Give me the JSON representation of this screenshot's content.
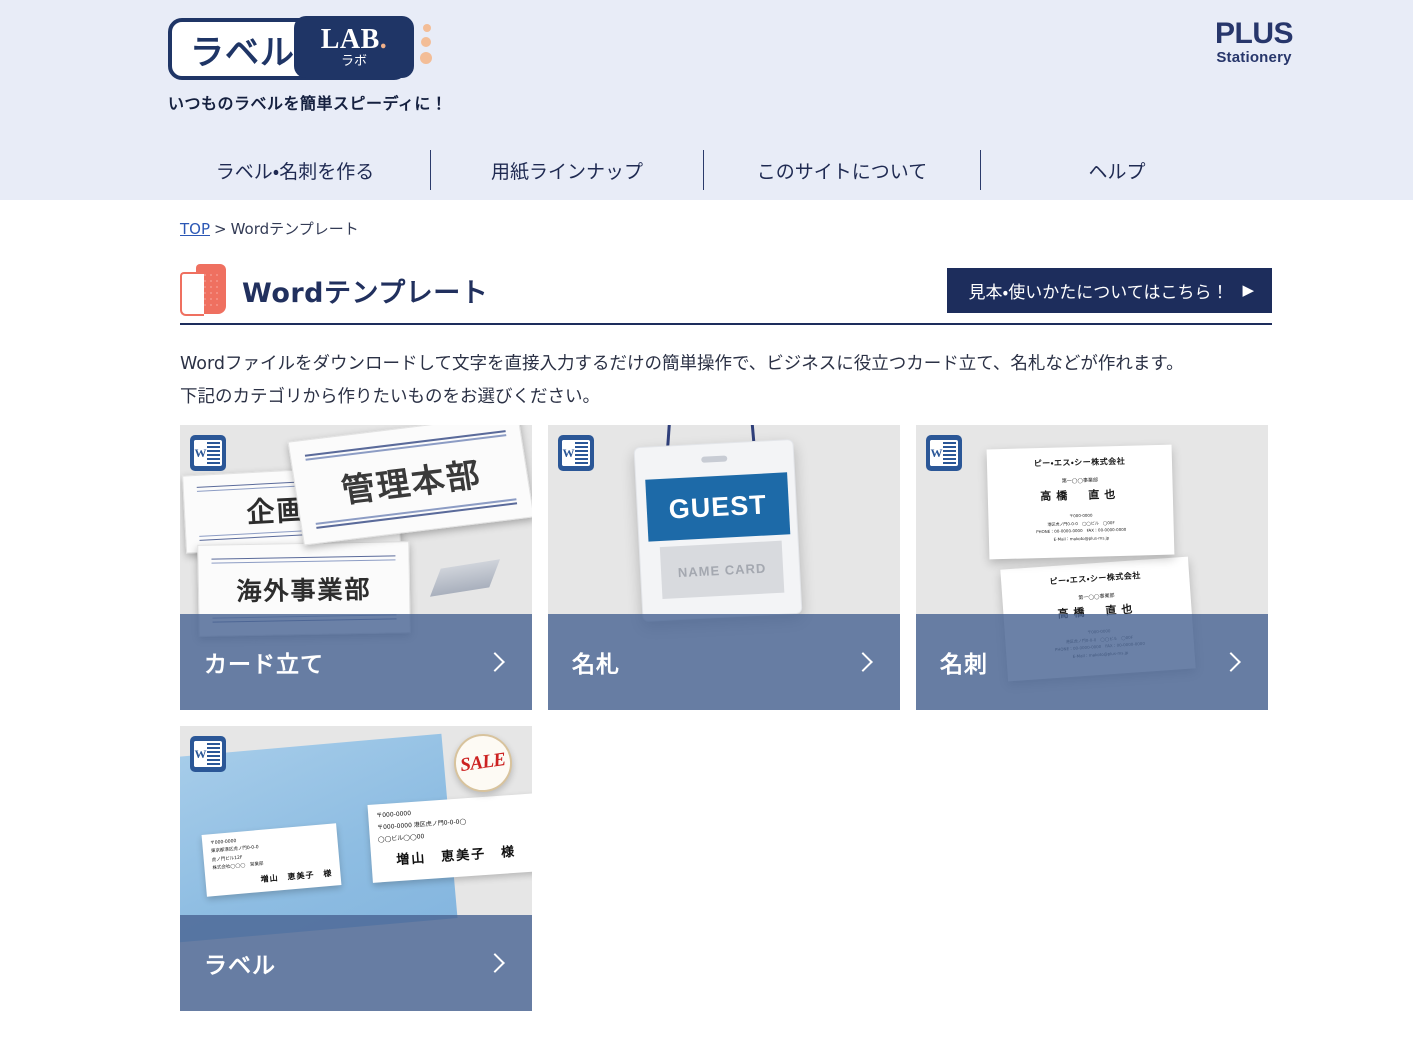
{
  "header": {
    "logo": {
      "jp_text": "ラベル",
      "lab_text": "LAB",
      "lab_dot": ".",
      "lab_sub": "ラボ",
      "tagline": "いつものラベルを簡単スピーディに！"
    },
    "brand": {
      "main": "PLUS",
      "sub": "Stationery"
    },
    "nav": [
      {
        "label": "ラベル・名刺を作る"
      },
      {
        "label": "用紙ラインナップ"
      },
      {
        "label": "このサイトについて"
      },
      {
        "label": "ヘルプ"
      }
    ]
  },
  "breadcrumb": {
    "home": "TOP",
    "separator": ">",
    "current": "Wordテンプレート"
  },
  "page": {
    "title": "Wordテンプレート",
    "guide_button": "見本・使いかたについてはこちら！",
    "guide_arrow": "▶",
    "lead_line1": "Wordファイルをダウンロードして文字を直接入力するだけの簡単操作で、ビジネスに役立つカード立て、名札などが作れます。",
    "lead_line2": "下記のカテゴリから作りたいものをお選びください。"
  },
  "cards": [
    {
      "label": "カード立て",
      "icon": "word-icon",
      "art": {
        "plate_a": "企画部",
        "plate_b": "管理本部",
        "plate_c": "海外事業部"
      }
    },
    {
      "label": "名札",
      "icon": "word-icon",
      "art": {
        "guest": "GUEST",
        "namecard": "NAME CARD"
      }
    },
    {
      "label": "名刺",
      "icon": "word-icon",
      "art": {
        "company": "ピー・エス・シー株式会社",
        "department": "第一◯◯事業部",
        "name": "高橋　直也",
        "info_line1": "〒000-0000",
        "info_line2": "港区虎ノ門0-0-0　◯◯ビル　◯00F",
        "info_line3": "PHONE：00-0000-0000　FAX：00-0000-0000",
        "info_line4": "E-Mail：makoto@plus-ms.jp"
      }
    },
    {
      "label": "ラベル",
      "icon": "word-icon",
      "art": {
        "label1_line1": "〒000-0000",
        "label1_line2": "東京都港区虎ノ門0-0-0",
        "label1_line3": "虎ノ門ビル12F",
        "label1_line4": "株式会社◯◯◯　営業部",
        "label1_name": "増山　恵美子　様",
        "label2_line1": "〒000-0000",
        "label2_line2": "〒000-0000 港区虎ノ門0-0-0◯",
        "label2_line3": "◯◯ビル◯◯00",
        "label2_name": "増山　恵美子　様",
        "stamp": "SALE"
      }
    }
  ],
  "colors": {
    "header_bg": "#e8ecf7",
    "navy": "#1d2d5c",
    "card_label_bg": "#4a6594",
    "accent_coral": "#ef7060",
    "link_blue": "#2b57b5"
  }
}
